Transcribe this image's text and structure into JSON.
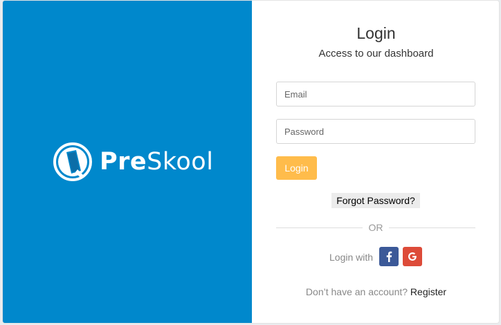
{
  "brand": {
    "name_bold": "Pre",
    "name_light": "Skool",
    "panel_color": "#0088cc"
  },
  "login": {
    "title": "Login",
    "subtitle": "Access to our dashboard",
    "email_placeholder": "Email",
    "password_placeholder": "Password",
    "button_label": "Login",
    "button_color": "#ffbc4b",
    "forgot_label": "Forgot Password?",
    "or_label": "OR",
    "login_with_label": "Login with",
    "social": [
      {
        "icon": "facebook-icon",
        "color": "#3b5998"
      },
      {
        "icon": "google-icon",
        "color": "#dd4b39"
      }
    ],
    "register_prompt": "Don’t have an account?",
    "register_label": "Register"
  }
}
